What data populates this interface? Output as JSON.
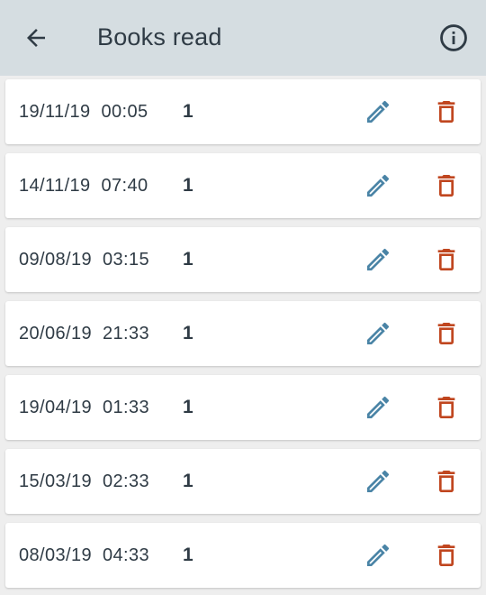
{
  "header": {
    "title": "Books read",
    "back_icon": "arrow-back-icon",
    "info_icon": "info-outline-icon"
  },
  "colors": {
    "appbar": "#d5dde1",
    "text": "#2f3b45",
    "edit": "#4a84a6",
    "delete": "#c0461f"
  },
  "entries": [
    {
      "date": "19/11/19",
      "time": "00:05",
      "count": "1"
    },
    {
      "date": "14/11/19",
      "time": "07:40",
      "count": "1"
    },
    {
      "date": "09/08/19",
      "time": "03:15",
      "count": "1"
    },
    {
      "date": "20/06/19",
      "time": "21:33",
      "count": "1"
    },
    {
      "date": "19/04/19",
      "time": "01:33",
      "count": "1"
    },
    {
      "date": "15/03/19",
      "time": "02:33",
      "count": "1"
    },
    {
      "date": "08/03/19",
      "time": "04:33",
      "count": "1"
    }
  ]
}
